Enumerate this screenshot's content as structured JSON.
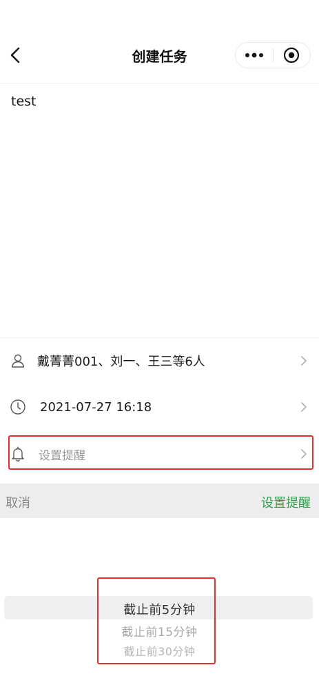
{
  "navbar": {
    "title": "创建任务"
  },
  "task": {
    "content": "test"
  },
  "rows": {
    "members": "戴菁菁001、刘一、王三等6人",
    "deadline": "2021-07-27 16:18",
    "reminder_placeholder": "设置提醒"
  },
  "picker": {
    "cancel_label": "取消",
    "confirm_label": "设置提醒",
    "options": [
      "截止前5分钟",
      "截止前15分钟",
      "截止前30分钟"
    ]
  },
  "colors": {
    "accent_green": "#2ea34a",
    "highlight_red": "#e5302f"
  },
  "icons": {
    "back": "chevron-left-icon",
    "more": "more-dots-icon",
    "close_capsule": "target-circle-icon",
    "user": "user-icon",
    "clock": "clock-icon",
    "bell": "bell-icon",
    "chevron": "chevron-right-icon"
  }
}
